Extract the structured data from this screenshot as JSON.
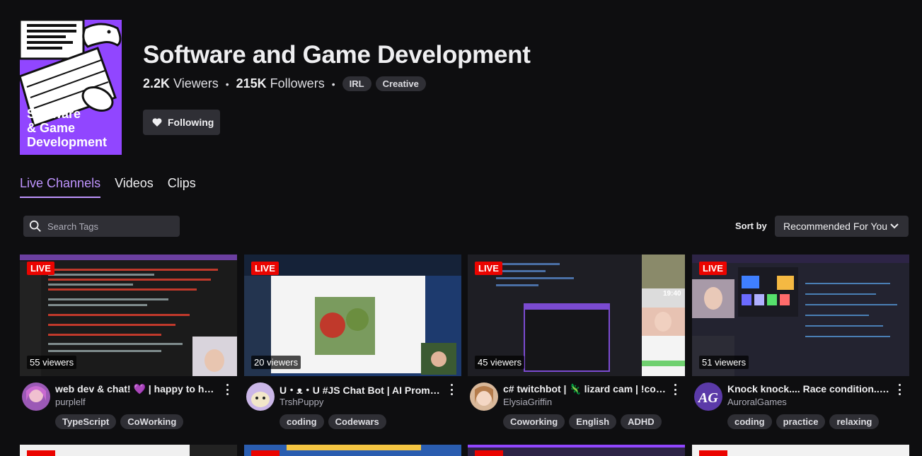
{
  "category": {
    "cover_text": [
      "Software",
      "& Game",
      "Development"
    ],
    "title": "Software and Game Development",
    "viewers_count": "2.2K",
    "viewers_label": "Viewers",
    "followers_count": "215K",
    "followers_label": "Followers",
    "tags": [
      "IRL",
      "Creative"
    ],
    "follow_label": "Following"
  },
  "tabs": [
    "Live Channels",
    "Videos",
    "Clips"
  ],
  "search": {
    "placeholder": "Search Tags"
  },
  "sort": {
    "label": "Sort by",
    "value": "Recommended For You"
  },
  "live_badge": "LIVE",
  "channels": [
    {
      "title": "web dev & chat! 💜 | happy to help | !dlux",
      "streamer": "purplelf",
      "viewers": "55 viewers",
      "tags": [
        "TypeScript",
        "CoWorking"
      ],
      "thumb_color": "#1b1b1b"
    },
    {
      "title": "U・ᴥ・U #JS Chat Bot | AI Prompt Engineering",
      "streamer": "TrshPuppy",
      "viewers": "20 viewers",
      "tags": [
        "coding",
        "Codewars"
      ],
      "thumb_color": "#1d3a6e"
    },
    {
      "title": "c# twitchbot | 🦎 lizard cam | !commands",
      "streamer": "ElysiaGriffin",
      "viewers": "45 viewers",
      "tags": [
        "Coworking",
        "English",
        "ADHD"
      ],
      "thumb_color": "#1e1e24"
    },
    {
      "title": "Knock knock.... Race condition...... Who's there?",
      "streamer": "AuroralGames",
      "viewers": "51 viewers",
      "tags": [
        "coding",
        "practice",
        "relaxing"
      ],
      "thumb_color": "#232330"
    }
  ]
}
